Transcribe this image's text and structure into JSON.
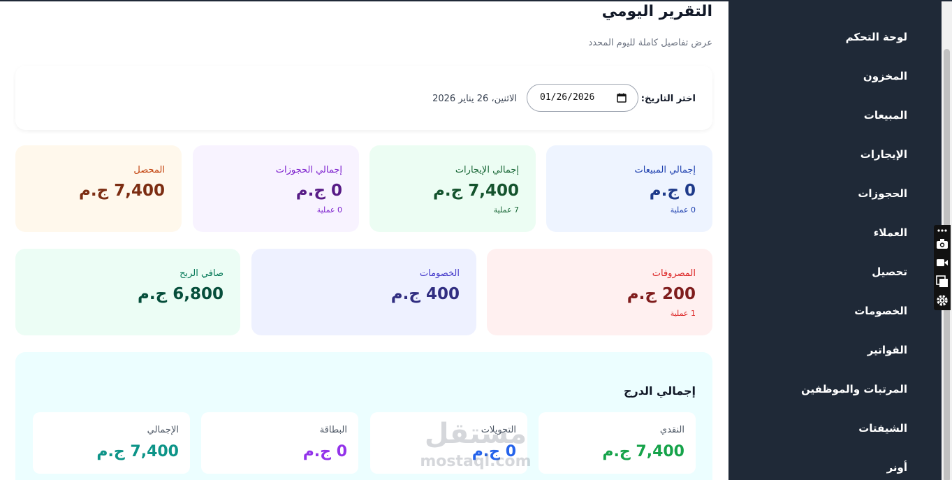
{
  "sidebar": {
    "items": [
      {
        "label": "لوحة التحكم"
      },
      {
        "label": "المخزون"
      },
      {
        "label": "المبيعات"
      },
      {
        "label": "الإيجارات"
      },
      {
        "label": "الحجوزات"
      },
      {
        "label": "العملاء"
      },
      {
        "label": "تحصيل"
      },
      {
        "label": "الخصومات"
      },
      {
        "label": "الفواتير"
      },
      {
        "label": "المرتبات والموظفين"
      },
      {
        "label": "الشيفتات"
      },
      {
        "label": "أونر"
      }
    ]
  },
  "header": {
    "title": "التقرير اليومي",
    "subtitle": "عرض تفاصيل كاملة لليوم المحدد"
  },
  "date_picker": {
    "label": "اختر التاريخ:",
    "value": "01/26/2026",
    "long_date": "الاثنين، 26 يناير 2026"
  },
  "stats_row1": [
    {
      "label": "إجمالي المبيعات",
      "value": "0 ج.م",
      "ops": "0 عملية",
      "bg": "#eef4ff",
      "label_color": "#1e40af",
      "value_color": "#1e3a8a",
      "ops_color": "#1e40af"
    },
    {
      "label": "إجمالي الإيجارات",
      "value": "7,400 ج.م",
      "ops": "7 عملية",
      "bg": "#ecfdf3",
      "label_color": "#166534",
      "value_color": "#14532d",
      "ops_color": "#166534"
    },
    {
      "label": "إجمالي الحجوزات",
      "value": "0 ج.م",
      "ops": "0 عملية",
      "bg": "#f8f3ff",
      "label_color": "#7e22ce",
      "value_color": "#581c87",
      "ops_color": "#7e22ce"
    },
    {
      "label": "المحصل",
      "value": "7,400 ج.م",
      "bg": "#fff8ec",
      "label_color": "#c2410c",
      "value_color": "#7c2d12"
    }
  ],
  "stats_row2": [
    {
      "label": "المصروفات",
      "value": "200 ج.م",
      "ops": "1 عملية",
      "bg": "#fff0f0",
      "label_color": "#dc2626",
      "value_color": "#7f1d1d",
      "ops_color": "#dc2626"
    },
    {
      "label": "الخصومات",
      "value": "400 ج.م",
      "bg": "#eef1ff",
      "label_color": "#4338ca",
      "value_color": "#312e81"
    },
    {
      "label": "صافي الربح",
      "value": "6,800 ج.م",
      "bg": "#ecfdf5",
      "label_color": "#047857",
      "value_color": "#064e3b"
    }
  ],
  "drawer": {
    "title": "إجمالي الدرج",
    "cards": [
      {
        "label": "النقدي",
        "value": "7,400 ج.م",
        "value_color": "#16a34a"
      },
      {
        "label": "التحويلات",
        "value": "0 ج.م",
        "value_color": "#2563eb"
      },
      {
        "label": "البطاقة",
        "value": "0 ج.م",
        "value_color": "#9333ea"
      },
      {
        "label": "الإجمالي",
        "value": "7,400 ج.م",
        "value_color": "#0d9488"
      }
    ]
  },
  "watermark": {
    "arabic": "مستقل",
    "latin": "mostaql.com"
  }
}
